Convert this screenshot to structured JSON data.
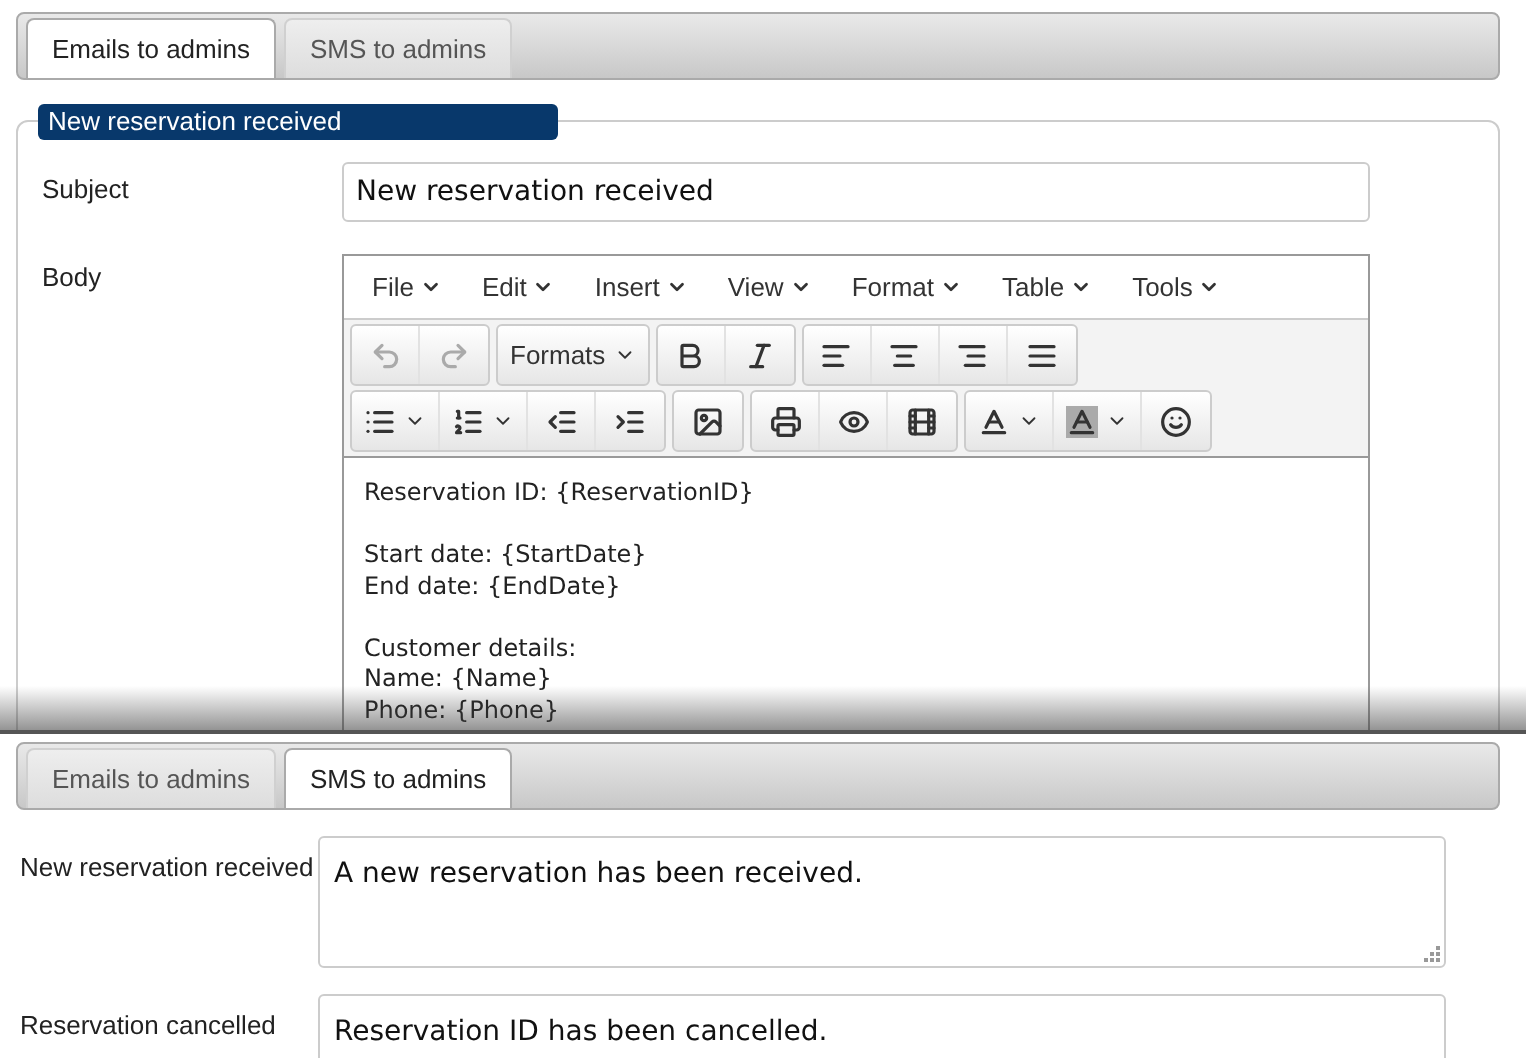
{
  "email_panel": {
    "tabs": [
      {
        "label": "Emails to admins",
        "selected": true
      },
      {
        "label": "SMS to admins",
        "selected": false
      }
    ],
    "legend": "New reservation received",
    "subject": {
      "label": "Subject",
      "value": "New reservation received"
    },
    "body": {
      "label": "Body",
      "menu": [
        "File",
        "Edit",
        "Insert",
        "View",
        "Format",
        "Table",
        "Tools"
      ],
      "toolbar": [
        [
          [
            {
              "kind": "icon",
              "disabled": true
            },
            {
              "kind": "icon",
              "disabled": true
            }
          ],
          [
            {
              "kind": "menu",
              "label": "Formats",
              "disabled": false
            }
          ],
          [
            {
              "kind": "icon",
              "disabled": false
            },
            {
              "kind": "icon",
              "disabled": false
            }
          ],
          [
            {
              "kind": "icon",
              "disabled": false
            },
            {
              "kind": "icon",
              "disabled": false
            },
            {
              "kind": "icon",
              "disabled": false
            },
            {
              "kind": "icon",
              "disabled": false
            }
          ]
        ],
        [
          [
            {
              "kind": "split",
              "disabled": false
            },
            {
              "kind": "split",
              "disabled": false
            },
            {
              "kind": "icon",
              "disabled": false
            },
            {
              "kind": "icon",
              "disabled": false
            }
          ],
          [
            {
              "kind": "icon",
              "disabled": false
            }
          ],
          [
            {
              "kind": "icon",
              "disabled": false
            },
            {
              "kind": "icon",
              "disabled": false
            },
            {
              "kind": "icon",
              "disabled": false
            }
          ],
          [
            {
              "kind": "split",
              "disabled": false
            },
            {
              "kind": "split",
              "disabled": false
            },
            {
              "kind": "icon",
              "disabled": false
            }
          ]
        ]
      ],
      "content": [
        [
          "Reservation ID: {ReservationID}"
        ],
        [
          "Start date: {StartDate}",
          "End date: {EndDate}"
        ],
        [
          "Customer details:",
          "Name: {Name}",
          "Phone: {Phone}"
        ]
      ]
    }
  },
  "sms_panel": {
    "tabs": [
      {
        "label": "Emails to admins",
        "selected": false
      },
      {
        "label": "SMS to admins",
        "selected": true
      }
    ],
    "fields": [
      {
        "label": "New reservation received",
        "value": "A new reservation has been received."
      },
      {
        "label": "Reservation cancelled",
        "value": "Reservation ID has been cancelled."
      }
    ]
  }
}
